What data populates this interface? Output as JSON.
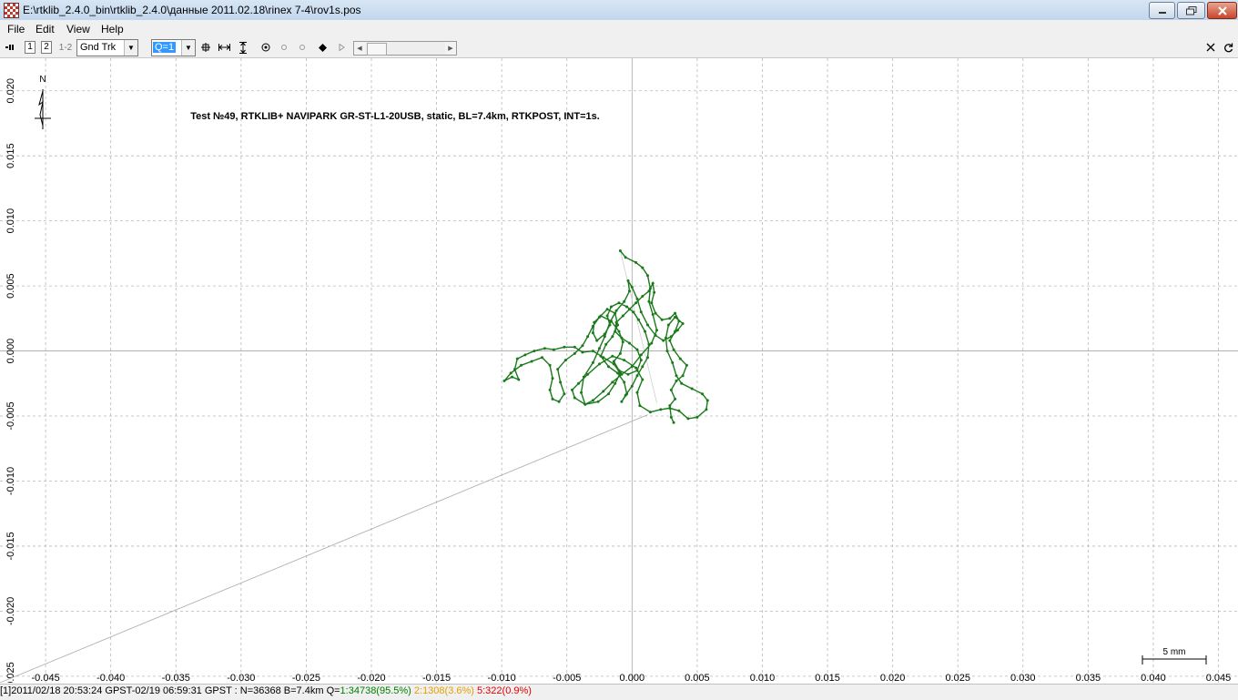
{
  "window": {
    "title": "E:\\rtklib_2.4.0_bin\\rtklib_2.4.0\\данные 2011.02.18\\rinex 7-4\\rov1s.pos"
  },
  "menu": [
    "File",
    "Edit",
    "View",
    "Help"
  ],
  "toolbar": {
    "btn1": "1",
    "btn2": "2",
    "btn12": "1-2",
    "plot_type": "Gnd Trk",
    "quality": "Q=1"
  },
  "plot": {
    "title": "Test №49, RTKLIB+ NAVIPARK GR-ST-L1-20USB, static, BL=7.4km, RTKPOST, INT=1s.",
    "north_label": "N",
    "scale_label": "5 mm",
    "track_color": "#1a7a1a",
    "grid_color": "#b8b8b8",
    "x_ticks": [
      "-0.045",
      "-0.040",
      "-0.035",
      "-0.030",
      "-0.025",
      "-0.020",
      "-0.015",
      "-0.010",
      "-0.005",
      "0.000",
      "0.005",
      "0.010",
      "0.015",
      "0.020",
      "0.025",
      "0.030",
      "0.035",
      "0.040",
      "0.045"
    ],
    "y_ticks": [
      "0.020",
      "0.015",
      "0.010",
      "0.005",
      "0.000",
      "-0.005",
      "-0.010",
      "-0.015",
      "-0.020",
      "-0.025"
    ]
  },
  "chart_data": {
    "type": "scatter",
    "title": "Test №49, RTKLIB+ NAVIPARK GR-ST-L1-20USB, static, BL=7.4km, RTKPOST, INT=1s.",
    "xlabel": "",
    "ylabel": "",
    "xlim": [
      -0.0485,
      0.0465
    ],
    "ylim": [
      -0.0255,
      0.0225
    ],
    "grid": true,
    "series": [
      {
        "values": [
          [
            -0.0009,
            0.0077
          ],
          [
            -0.0005,
            0.0072
          ],
          [
            0.0003,
            0.0068
          ],
          [
            0.0008,
            0.0064
          ],
          [
            0.0012,
            0.0058
          ],
          [
            0.0014,
            0.0048
          ],
          [
            0.0013,
            0.0038
          ],
          [
            0.0016,
            0.0028
          ],
          [
            0.0019,
            0.0016
          ],
          [
            0.0015,
            0.0006
          ],
          [
            0.0007,
            -0.0003
          ],
          [
            0.0,
            -0.0012
          ],
          [
            -0.0008,
            -0.0018
          ],
          [
            -0.0015,
            -0.0024
          ],
          [
            -0.0022,
            -0.0031
          ],
          [
            -0.003,
            -0.0038
          ],
          [
            -0.0036,
            -0.0041
          ],
          [
            -0.0039,
            -0.0032
          ],
          [
            -0.0037,
            -0.002
          ],
          [
            -0.003,
            -0.0009
          ],
          [
            -0.0025,
            0.0002
          ],
          [
            -0.0021,
            0.0011
          ],
          [
            -0.0017,
            0.0022
          ],
          [
            -0.0012,
            0.0031
          ],
          [
            -0.0006,
            0.0038
          ],
          [
            -0.0002,
            0.0046
          ],
          [
            -0.0003,
            0.0054
          ],
          [
            0.0,
            0.0049
          ],
          [
            0.0004,
            0.004
          ],
          [
            0.0007,
            0.003
          ],
          [
            0.0012,
            0.002
          ],
          [
            0.0018,
            0.0012
          ],
          [
            0.0024,
            0.0008
          ],
          [
            0.003,
            0.0011
          ],
          [
            0.0035,
            0.0016
          ],
          [
            0.0039,
            0.0021
          ],
          [
            0.0033,
            0.0026
          ],
          [
            0.0028,
            0.002
          ],
          [
            0.0026,
            0.001
          ],
          [
            0.0027,
            0.0
          ],
          [
            0.0031,
            -0.0009
          ],
          [
            0.0034,
            -0.0019
          ],
          [
            0.0038,
            -0.0025
          ],
          [
            0.0046,
            -0.0029
          ],
          [
            0.0054,
            -0.0033
          ],
          [
            0.0058,
            -0.0038
          ],
          [
            0.0057,
            -0.0045
          ],
          [
            0.005,
            -0.0051
          ],
          [
            0.0043,
            -0.0052
          ],
          [
            0.0036,
            -0.0046
          ],
          [
            0.0029,
            -0.0044
          ],
          [
            0.0022,
            -0.0045
          ],
          [
            0.0014,
            -0.0047
          ],
          [
            0.0006,
            -0.0042
          ],
          [
            0.0004,
            -0.0032
          ],
          [
            0.0008,
            -0.0022
          ],
          [
            0.0003,
            -0.0013
          ],
          [
            -0.0006,
            -0.0007
          ],
          [
            -0.0015,
            -0.0004
          ],
          [
            -0.0025,
            -0.001
          ],
          [
            -0.0034,
            -0.0018
          ],
          [
            -0.0041,
            -0.0025
          ],
          [
            -0.0046,
            -0.003
          ],
          [
            -0.0044,
            -0.0036
          ],
          [
            -0.0036,
            -0.0041
          ],
          [
            -0.0026,
            -0.0039
          ],
          [
            -0.0018,
            -0.0033
          ],
          [
            -0.0013,
            -0.0025
          ],
          [
            -0.0009,
            -0.0017
          ],
          [
            -0.0014,
            -0.001
          ],
          [
            -0.0022,
            -0.0005
          ],
          [
            -0.003,
            0.0
          ],
          [
            -0.0038,
            -0.0001
          ],
          [
            -0.0044,
            0.0003
          ],
          [
            -0.0052,
            0.0003
          ],
          [
            -0.006,
            0.0001
          ],
          [
            -0.0067,
            0.0002
          ],
          [
            -0.0075,
            0.0
          ],
          [
            -0.0082,
            -0.0003
          ],
          [
            -0.0088,
            -0.0006
          ],
          [
            -0.009,
            -0.0014
          ],
          [
            -0.0087,
            -0.0022
          ],
          [
            -0.0092,
            -0.002
          ],
          [
            -0.0098,
            -0.0023
          ],
          [
            -0.0093,
            -0.0017
          ],
          [
            -0.0085,
            -0.0011
          ],
          [
            -0.0077,
            -0.0008
          ],
          [
            -0.0069,
            -0.0005
          ],
          [
            -0.0063,
            -0.0011
          ],
          [
            -0.0061,
            -0.0021
          ],
          [
            -0.0063,
            -0.003
          ],
          [
            -0.0061,
            -0.0037
          ],
          [
            -0.0056,
            -0.0039
          ],
          [
            -0.0052,
            -0.0033
          ],
          [
            -0.0055,
            -0.0024
          ],
          [
            -0.0057,
            -0.0014
          ],
          [
            -0.0051,
            -0.0007
          ],
          [
            -0.0044,
            -0.0002
          ],
          [
            -0.0038,
            0.0004
          ],
          [
            -0.0034,
            0.0011
          ],
          [
            -0.003,
            0.0019
          ],
          [
            -0.0025,
            0.0026
          ],
          [
            -0.0019,
            0.0032
          ],
          [
            -0.0013,
            0.0029
          ],
          [
            -0.0011,
            0.002
          ],
          [
            -0.0015,
            0.0011
          ],
          [
            -0.002,
            0.0005
          ],
          [
            -0.0024,
            -0.0004
          ],
          [
            -0.0018,
            -0.0012
          ],
          [
            -0.0011,
            -0.0017
          ],
          [
            -0.0006,
            -0.0024
          ],
          [
            -0.0004,
            -0.0033
          ],
          [
            -0.0008,
            -0.0039
          ],
          [
            -0.0005,
            -0.0034
          ],
          [
            0.0,
            -0.0027
          ],
          [
            0.0004,
            -0.0019
          ],
          [
            0.0008,
            -0.0012
          ],
          [
            0.0012,
            -0.0005
          ],
          [
            0.0013,
            0.0005
          ],
          [
            0.001,
            0.0015
          ],
          [
            0.0005,
            0.0024
          ],
          [
            0.0001,
            0.003
          ],
          [
            -0.0004,
            0.0034
          ],
          [
            -0.001,
            0.0037
          ],
          [
            -0.0016,
            0.0034
          ],
          [
            -0.0019,
            0.0027
          ],
          [
            -0.0017,
            0.002
          ],
          [
            -0.0021,
            0.0013
          ],
          [
            -0.0027,
            0.0008
          ],
          [
            -0.003,
            0.0014
          ],
          [
            -0.0029,
            0.0022
          ],
          [
            -0.0024,
            0.0027
          ],
          [
            -0.0016,
            0.0023
          ],
          [
            -0.001,
            0.0015
          ],
          [
            -0.0007,
            0.0007
          ],
          [
            -0.0009,
            -0.0002
          ],
          [
            -0.0014,
            -0.0008
          ],
          [
            -0.001,
            -0.0015
          ],
          [
            -0.0003,
            -0.0018
          ],
          [
            0.0004,
            -0.0015
          ],
          [
            0.0007,
            -0.0007
          ],
          [
            0.0004,
            0.0001
          ],
          [
            -0.0002,
            0.0006
          ],
          [
            -0.0008,
            0.001
          ],
          [
            -0.0013,
            0.0015
          ],
          [
            -0.0012,
            0.0022
          ],
          [
            -0.0007,
            0.0027
          ],
          [
            -0.0002,
            0.0032
          ],
          [
            0.0003,
            0.0037
          ],
          [
            0.0008,
            0.0042
          ],
          [
            0.0013,
            0.0046
          ],
          [
            0.0016,
            0.0052
          ],
          [
            0.0017,
            0.0045
          ],
          [
            0.0015,
            0.0037
          ],
          [
            0.0018,
            0.0029
          ],
          [
            0.0023,
            0.0024
          ],
          [
            0.0029,
            0.0025
          ],
          [
            0.0033,
            0.0029
          ],
          [
            0.0036,
            0.0023
          ],
          [
            0.0033,
            0.0015
          ],
          [
            0.0029,
            0.0008
          ],
          [
            0.0032,
            0.0001
          ],
          [
            0.0037,
            -0.0006
          ],
          [
            0.0042,
            -0.0011
          ],
          [
            0.0039,
            -0.0019
          ],
          [
            0.0034,
            -0.0023
          ],
          [
            0.003,
            -0.003
          ],
          [
            0.0033,
            -0.0037
          ],
          [
            0.0029,
            -0.0042
          ],
          [
            0.003,
            -0.0051
          ],
          [
            0.0032,
            -0.0055
          ]
        ]
      }
    ]
  },
  "status": {
    "prefix": "[1]2011/02/18 20:53:24 GPST-02/19 06:59:31 GPST : N=36368 B=7.4km Q=",
    "q1": "1:34738(95.5%)",
    "q2": "2:1308(3.6%)",
    "q5": "5:322(0.9%)",
    "q1_color": "#008000",
    "q2_color": "#e6a000",
    "q5_color": "#e00000"
  }
}
